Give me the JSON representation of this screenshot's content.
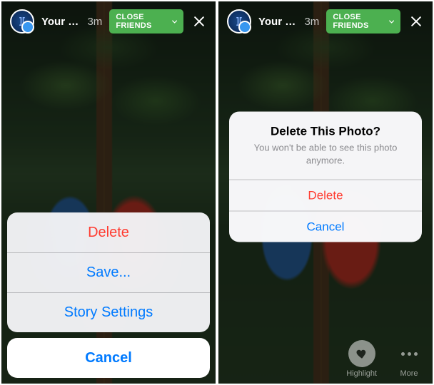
{
  "header": {
    "story_title": "Your St…",
    "time": "3m",
    "audience_label": "CLOSE FRIENDS"
  },
  "action_sheet": {
    "delete": "Delete",
    "save": "Save...",
    "settings": "Story Settings",
    "cancel": "Cancel"
  },
  "alert": {
    "title": "Delete This Photo?",
    "message": "You won't be able to see this photo anymore.",
    "delete": "Delete",
    "cancel": "Cancel"
  },
  "bottom": {
    "highlight": "Highlight",
    "more": "More"
  }
}
